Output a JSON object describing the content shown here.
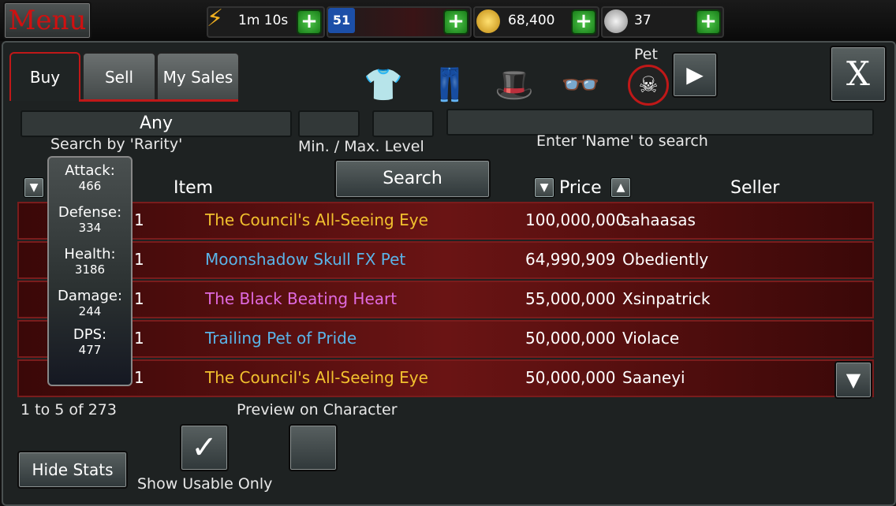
{
  "topbar": {
    "menu_label": "Menu",
    "energy_timer": "1m 10s",
    "level": "51",
    "gold": "68,400",
    "silver": "37",
    "plus_symbol": "+"
  },
  "tabs": [
    {
      "label": "Buy"
    },
    {
      "label": "Sell"
    },
    {
      "label": "My Sales"
    }
  ],
  "categories": {
    "shirt_glyph": "👕",
    "pants_glyph": "👖",
    "hat_glyph": "🎩",
    "glasses_glyph": "👓",
    "pet_glyph": "☠",
    "pet_label": "Pet",
    "next_glyph": "▶",
    "close_label": "X"
  },
  "filters": {
    "rarity_value": "Any",
    "rarity_label": "Search by 'Rarity'",
    "level_label": "Min. / Max. Level",
    "name_label": "Enter 'Name' to search",
    "search_button": "Search"
  },
  "columns": {
    "item": "Item",
    "price": "Price",
    "seller": "Seller",
    "sort_down": "▼",
    "sort_up": "▲"
  },
  "stats": {
    "attack_label": "Attack:",
    "attack": "466",
    "defense_label": "Defense:",
    "defense": "334",
    "health_label": "Health:",
    "health": "3186",
    "damage_label": "Damage:",
    "damage": "244",
    "dps_label": "DPS:",
    "dps": "477"
  },
  "rows": [
    {
      "level": "1",
      "name": "The Council's All-Seeing Eye",
      "price": "100,000,000",
      "seller": "sahaasas",
      "color": "#f2c12e"
    },
    {
      "level": "1",
      "name": "Moonshadow Skull FX Pet",
      "price": "64,990,909",
      "seller": "Obediently",
      "color": "#5ab4e8"
    },
    {
      "level": "1",
      "name": "The Black Beating Heart",
      "price": "55,000,000",
      "seller": "Xsinpatrick",
      "color": "#e06ae0"
    },
    {
      "level": "1",
      "name": "Trailing Pet of Pride",
      "price": "50,000,000",
      "seller": "Violace",
      "color": "#5ab4e8"
    },
    {
      "level": "1",
      "name": "The Council's All-Seeing Eye",
      "price": "50,000,000",
      "seller": "Saaneyi",
      "color": "#f2c12e"
    }
  ],
  "footer": {
    "pagination": "1 to 5 of 273",
    "preview_label": "Preview on Character",
    "hide_stats": "Hide Stats",
    "show_usable": "Show Usable Only",
    "check_glyph": "✓",
    "scroll_down_glyph": "▼"
  },
  "colors": {
    "accent_red": "#c01818",
    "plus_green": "#3cb83a"
  }
}
